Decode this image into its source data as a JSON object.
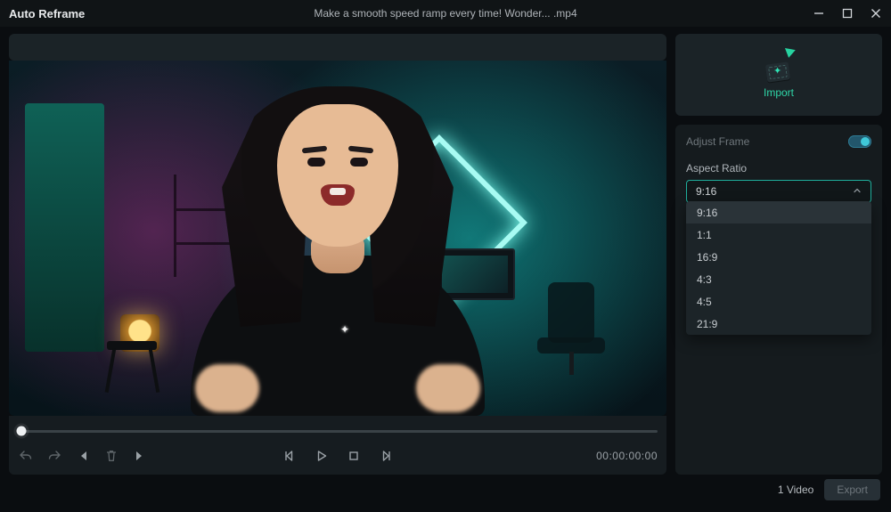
{
  "titlebar": {
    "app_title": "Auto Reframe",
    "file_title": "Make a smooth speed ramp every time!  Wonder... .mp4"
  },
  "import": {
    "label": "Import"
  },
  "adjust_frame": {
    "title": "Adjust Frame",
    "aspect_label": "Aspect Ratio",
    "aspect_value": "9:16",
    "options": [
      "9:16",
      "1:1",
      "16:9",
      "4:3",
      "4:5",
      "21:9"
    ]
  },
  "player": {
    "timecode": "00:00:00:00"
  },
  "footer": {
    "video_count": "1 Video",
    "export_label": "Export"
  },
  "icons": {
    "minimize": "minimize-icon",
    "maximize": "maximize-icon",
    "close": "close-icon",
    "undo": "undo-icon",
    "redo": "redo-icon",
    "prev_marker": "prev-marker-icon",
    "delete": "delete-icon",
    "next_marker": "next-marker-icon",
    "step_back": "step-back-icon",
    "play": "play-icon",
    "stop": "stop-icon",
    "step_fwd": "step-forward-icon",
    "chevron_up": "chevron-up-icon"
  }
}
